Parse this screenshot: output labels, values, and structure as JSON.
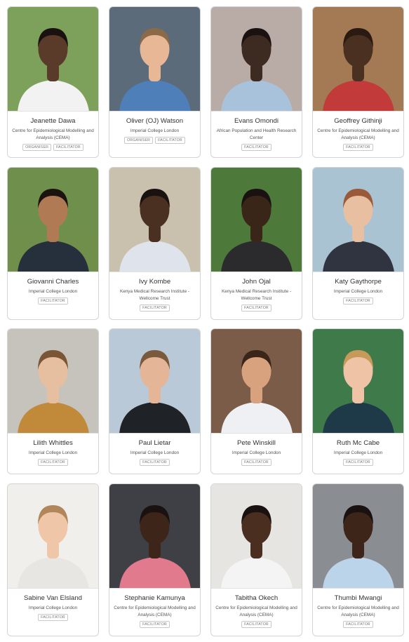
{
  "people": [
    {
      "name": "Jeanette Dawa",
      "org": "Centre for Epidemiological Modelling and Analysis (CEMA)",
      "roles": [
        "ORGANISER",
        "FACILITATOR"
      ],
      "bg": "#7da05a",
      "skin": "#5a3a28",
      "hair": "#1a1210",
      "shirt": "#f2f2f2"
    },
    {
      "name": "Oliver (OJ) Watson",
      "org": "Imperial College London",
      "roles": [
        "ORGANISER",
        "FACILITATOR"
      ],
      "bg": "#5b6b79",
      "skin": "#e8b896",
      "hair": "#8a6a48",
      "shirt": "#4f7fb8"
    },
    {
      "name": "Evans Omondi",
      "org": "African Population and Health Research Center",
      "roles": [
        "FACILITATOR"
      ],
      "bg": "#b9aca7",
      "skin": "#3d2a20",
      "hair": "#1a1210",
      "shirt": "#a9c2db"
    },
    {
      "name": "Geoffrey Githinji",
      "org": "Centre for Epidemiological Modelling and Analysis (CEMA)",
      "roles": [
        "FACILITATOR"
      ],
      "bg": "#a47a54",
      "skin": "#4a3020",
      "hair": "#2a1a12",
      "shirt": "#c23a3a"
    },
    {
      "name": "Giovanni Charles",
      "org": "Imperial College London",
      "roles": [
        "FACILITATOR"
      ],
      "bg": "#6f8f4c",
      "skin": "#b07a55",
      "hair": "#1c130e",
      "shirt": "#26303c"
    },
    {
      "name": "Ivy Kombe",
      "org": "Kenya Medical Research Institute - Wellcome Trust",
      "roles": [
        "FACILITATOR"
      ],
      "bg": "#c9c0ad",
      "skin": "#4a3020",
      "hair": "#1a1210",
      "shirt": "#dfe3ec"
    },
    {
      "name": "John Ojal",
      "org": "Kenya Medical Research Institute - Wellcome Trust",
      "roles": [
        "FACILITATOR"
      ],
      "bg": "#4d7a3a",
      "skin": "#3a2519",
      "hair": "#1a1210",
      "shirt": "#2b2b2e"
    },
    {
      "name": "Katy Gaythorpe",
      "org": "Imperial College London",
      "roles": [
        "FACILITATOR"
      ],
      "bg": "#a9c3d3",
      "skin": "#e9bfa2",
      "hair": "#9a5a3a",
      "shirt": "#2f3440"
    },
    {
      "name": "Lilith Whittles",
      "org": "Imperial College London",
      "roles": [
        "FACILITATOR"
      ],
      "bg": "#c5c3bb",
      "skin": "#e6bea0",
      "hair": "#7a5636",
      "shirt": "#c08a3a"
    },
    {
      "name": "Paul Lietar",
      "org": "Imperial College London",
      "roles": [
        "FACILITATOR"
      ],
      "bg": "#b9c9d8",
      "skin": "#e4b596",
      "hair": "#7a5a3c",
      "shirt": "#1f2226"
    },
    {
      "name": "Pete Winskill",
      "org": "Imperial College London",
      "roles": [
        "FACILITATOR"
      ],
      "bg": "#7a5c48",
      "skin": "#d9a27e",
      "hair": "#3a2618",
      "shirt": "#eef0f3"
    },
    {
      "name": "Ruth Mc Cabe",
      "org": "Imperial College London",
      "roles": [
        "FACILITATOR"
      ],
      "bg": "#3f7a4a",
      "skin": "#efc4a6",
      "hair": "#c79a5a",
      "shirt": "#1e3a48"
    },
    {
      "name": "Sabine Van Elsland",
      "org": "Imperial College London",
      "roles": [
        "FACILITATOR"
      ],
      "bg": "#f1efec",
      "skin": "#efc6a8",
      "hair": "#b0865a",
      "shirt": "#e8e6e3"
    },
    {
      "name": "Stephanie Kamunya",
      "org": "Centre for Epidemiological Modelling and Analysis (CEMA)",
      "roles": [
        "FACILITATOR"
      ],
      "bg": "#3e4046",
      "skin": "#3d2519",
      "hair": "#1a1210",
      "shirt": "#e07a8c"
    },
    {
      "name": "Tabitha Okech",
      "org": "Centre for Epidemiological Modelling and Analysis (CEMA)",
      "roles": [
        "FACILITATOR"
      ],
      "bg": "#e7e5e2",
      "skin": "#4a2e1f",
      "hair": "#1a1210",
      "shirt": "#f4f4f4"
    },
    {
      "name": "Thumbi Mwangi",
      "org": "Centre for Epidemiological Modelling and Analysis (CEMA)",
      "roles": [
        "FACILITATOR"
      ],
      "bg": "#8a8e93",
      "skin": "#3d2519",
      "hair": "#1a1210",
      "shirt": "#bcd4ea"
    }
  ]
}
